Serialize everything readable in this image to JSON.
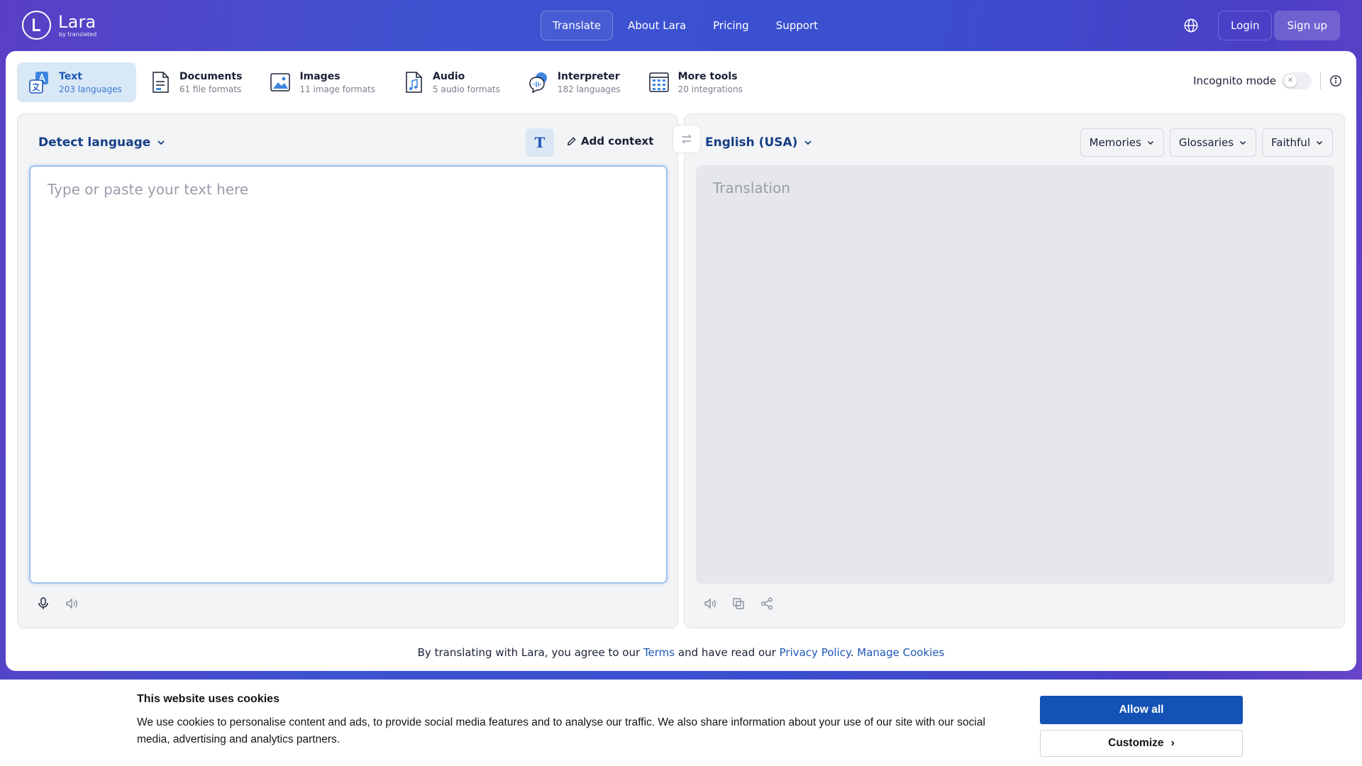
{
  "brand": {
    "name": "Lara",
    "sub": "by translated"
  },
  "nav": {
    "items": [
      {
        "label": "Translate",
        "active": true
      },
      {
        "label": "About Lara",
        "active": false
      },
      {
        "label": "Pricing",
        "active": false
      },
      {
        "label": "Support",
        "active": false
      }
    ],
    "login": "Login",
    "signup": "Sign up"
  },
  "tools": [
    {
      "title": "Text",
      "sub": "203 languages",
      "icon": "text-translate-icon",
      "active": true
    },
    {
      "title": "Documents",
      "sub": "61 file formats",
      "icon": "document-icon",
      "active": false
    },
    {
      "title": "Images",
      "sub": "11 image formats",
      "icon": "image-icon",
      "active": false
    },
    {
      "title": "Audio",
      "sub": "5 audio formats",
      "icon": "audio-file-icon",
      "active": false
    },
    {
      "title": "Interpreter",
      "sub": "182 languages",
      "icon": "interpreter-icon",
      "active": false
    },
    {
      "title": "More tools",
      "sub": "20 integrations",
      "icon": "grid-icon",
      "active": false
    }
  ],
  "incognito": {
    "label": "Incognito mode",
    "enabled": false
  },
  "source": {
    "language": "Detect language",
    "add_context": "Add context",
    "placeholder": "Type or paste your text here"
  },
  "target": {
    "language": "English (USA)",
    "placeholder": "Translation",
    "dropdowns": [
      "Memories",
      "Glossaries",
      "Faithful"
    ]
  },
  "legal": {
    "prefix": "By translating with Lara, you agree to our ",
    "terms": "Terms",
    "middle": " and have read our ",
    "privacy": "Privacy Policy",
    "dot": ". ",
    "cookies": "Manage Cookies"
  },
  "cookie_banner": {
    "title": "This website uses cookies",
    "body": "We use cookies to personalise content and ads, to provide social media features and to analyse our traffic. We also share information about your use of our site with our social media, advertising and analytics partners.",
    "allow_all": "Allow all",
    "customize": "Customize"
  },
  "colors": {
    "accent": "#1e58b5",
    "cookie_button": "#1452b5",
    "header_gradient_start": "#5a3fc4",
    "header_gradient_mid": "#3d53d1"
  }
}
